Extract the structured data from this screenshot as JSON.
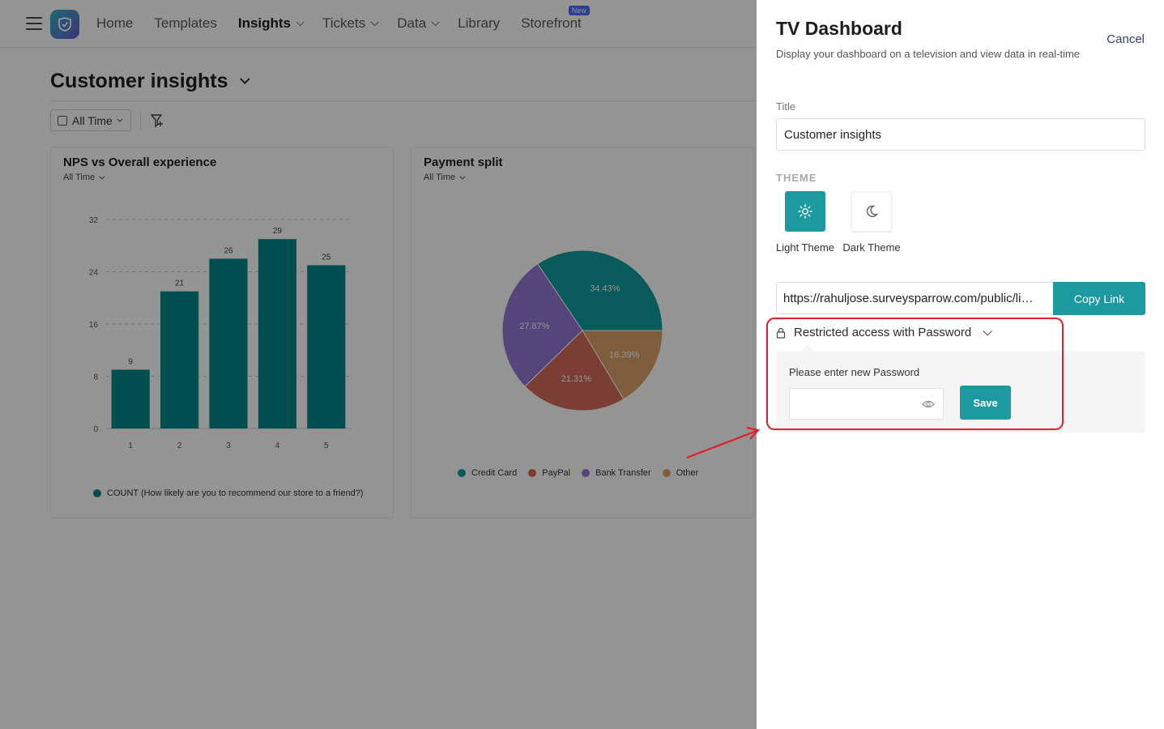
{
  "nav": {
    "items": [
      {
        "label": "Home",
        "active": false,
        "dropdown": false
      },
      {
        "label": "Templates",
        "active": false,
        "dropdown": false
      },
      {
        "label": "Insights",
        "active": true,
        "dropdown": true
      },
      {
        "label": "Tickets",
        "active": false,
        "dropdown": true
      },
      {
        "label": "Data",
        "active": false,
        "dropdown": true
      },
      {
        "label": "Library",
        "active": false,
        "dropdown": false
      },
      {
        "label": "Storefront",
        "active": false,
        "dropdown": false
      }
    ],
    "new_badge": "New"
  },
  "page": {
    "title": "Customer insights",
    "filter_label": "All Time"
  },
  "cards": {
    "nps": {
      "title": "NPS vs Overall experience",
      "subtitle": "All Time"
    },
    "payment": {
      "title": "Payment split",
      "subtitle": "All Time"
    }
  },
  "chart_data": [
    {
      "type": "bar",
      "title": "NPS vs Overall experience",
      "categories": [
        "1",
        "2",
        "3",
        "4",
        "5"
      ],
      "values": [
        9,
        21,
        26,
        29,
        25
      ],
      "ylim": [
        0,
        32
      ],
      "yticks": [
        "0",
        "8",
        "16",
        "24",
        "32"
      ],
      "grid": true,
      "series": [
        {
          "name": "COUNT (How likely are you to recommend our store to a friend?)",
          "values": [
            9,
            21,
            26,
            29,
            25
          ]
        }
      ],
      "color": "#00878a",
      "legend": "bottom"
    },
    {
      "type": "pie",
      "title": "Payment split",
      "labels": [
        "Credit Card",
        "Bank Transfer",
        "PayPal",
        "Other"
      ],
      "values": [
        34.43,
        27.87,
        21.31,
        16.39
      ],
      "display": [
        "34.43%",
        "27.87%",
        "21.31%",
        "16.39%"
      ],
      "legend_order": [
        "Credit Card",
        "PayPal",
        "Bank Transfer",
        "Other"
      ],
      "colors": {
        "Credit Card": "#0e9c9d",
        "PayPal": "#d46b5a",
        "Bank Transfer": "#9477d2",
        "Other": "#d9a168"
      },
      "legend": "bottom"
    }
  ],
  "panel": {
    "title": "TV Dashboard",
    "description": "Display your dashboard on a television and view data in real-time",
    "cancel_label": "Cancel",
    "title_field_label": "Title",
    "title_value": "Customer insights",
    "theme_label": "THEME",
    "themes": [
      {
        "label": "Light Theme",
        "icon": "sun-icon",
        "selected": true
      },
      {
        "label": "Dark Theme",
        "icon": "moon-icon",
        "selected": false
      }
    ],
    "link_value": "https://rahuljose.surveysparrow.com/public/li…",
    "copy_label": "Copy Link",
    "restrict_label": "Restricted access with Password",
    "password_prompt": "Please enter new Password",
    "password_value": "",
    "save_label": "Save"
  },
  "colors": {
    "accent": "#1c9a9f",
    "highlight": "#e0202a"
  }
}
